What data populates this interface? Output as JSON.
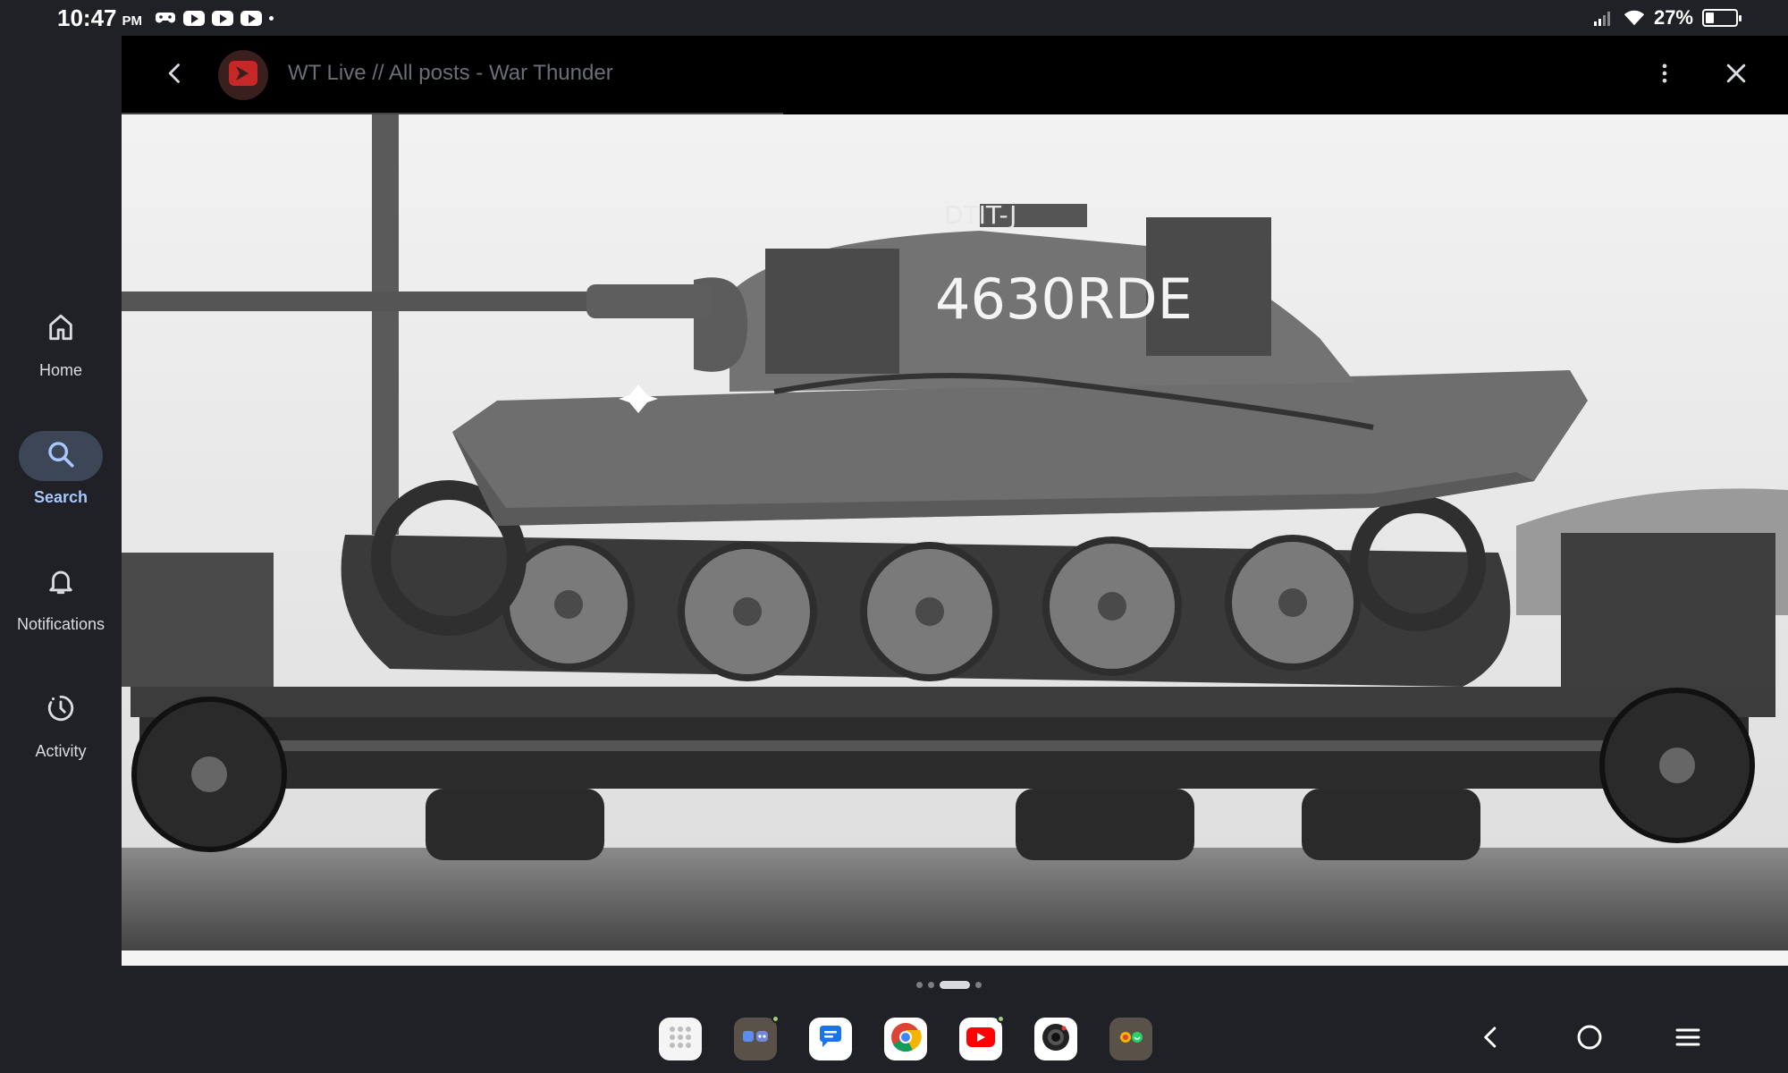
{
  "status_bar": {
    "time": "10:47",
    "ampm": "PM",
    "battery_percent": "27%",
    "battery_level": 0.27,
    "notification_icons": [
      "gamepad-icon",
      "youtube-icon",
      "youtube-icon",
      "youtube-icon"
    ]
  },
  "sidebar": {
    "items": [
      {
        "label": "Home",
        "icon": "home-icon",
        "active": false
      },
      {
        "label": "Search",
        "icon": "search-icon",
        "active": true
      },
      {
        "label": "Notifications",
        "icon": "bell-icon",
        "active": false
      },
      {
        "label": "Activity",
        "icon": "activity-icon",
        "active": false
      }
    ]
  },
  "viewer": {
    "title": "WT Live // All posts - War Thunder",
    "image_text": "4630RDE",
    "image_text_top": "DTIT-J"
  },
  "pager": {
    "count": 4,
    "active_index": 2
  },
  "taskbar": {
    "apps": [
      {
        "name": "app-drawer",
        "icon": "grid-icon"
      },
      {
        "name": "messaging-folder",
        "icon": "chat-folder-icon"
      },
      {
        "name": "messages",
        "icon": "message-bubble-icon"
      },
      {
        "name": "chrome",
        "icon": "chrome-icon"
      },
      {
        "name": "youtube",
        "icon": "youtube-icon"
      },
      {
        "name": "camera",
        "icon": "camera-icon"
      },
      {
        "name": "social-folder",
        "icon": "social-folder-icon"
      }
    ]
  },
  "colors": {
    "background": "#1f2126",
    "accent": "#a8c7fa",
    "active_pill": "#3c4657",
    "header": "#000000"
  }
}
